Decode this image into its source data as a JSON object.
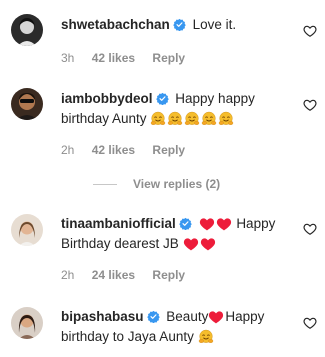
{
  "comments": [
    {
      "username": "shwetabachchan",
      "text": "Love it.",
      "time": "3h",
      "likes": "42 likes",
      "reply": "Reply"
    },
    {
      "username": "iambobbydeol",
      "text": "Happy happy birthday Aunty",
      "time": "2h",
      "likes": "42 likes",
      "reply": "Reply"
    },
    {
      "username": "tinaambaniofficial",
      "text_after_hearts": "Happy Birthday dearest JB",
      "time": "2h",
      "likes": "24 likes",
      "reply": "Reply"
    },
    {
      "username": "bipashabasu",
      "text_before_heart": "Beauty",
      "text_after_heart": "Happy birthday to Jaya Aunty",
      "time": "",
      "likes": "",
      "reply": ""
    }
  ],
  "view_replies": "View replies (2)",
  "colors": {
    "verified": "#3897f0",
    "heart": "#ed1c3a",
    "meta": "#8e8e8e",
    "text": "#262626"
  },
  "icons": {
    "like": "heart-outline-icon",
    "verified": "verified-badge-icon",
    "emoji": "hugging-face-emoji"
  }
}
